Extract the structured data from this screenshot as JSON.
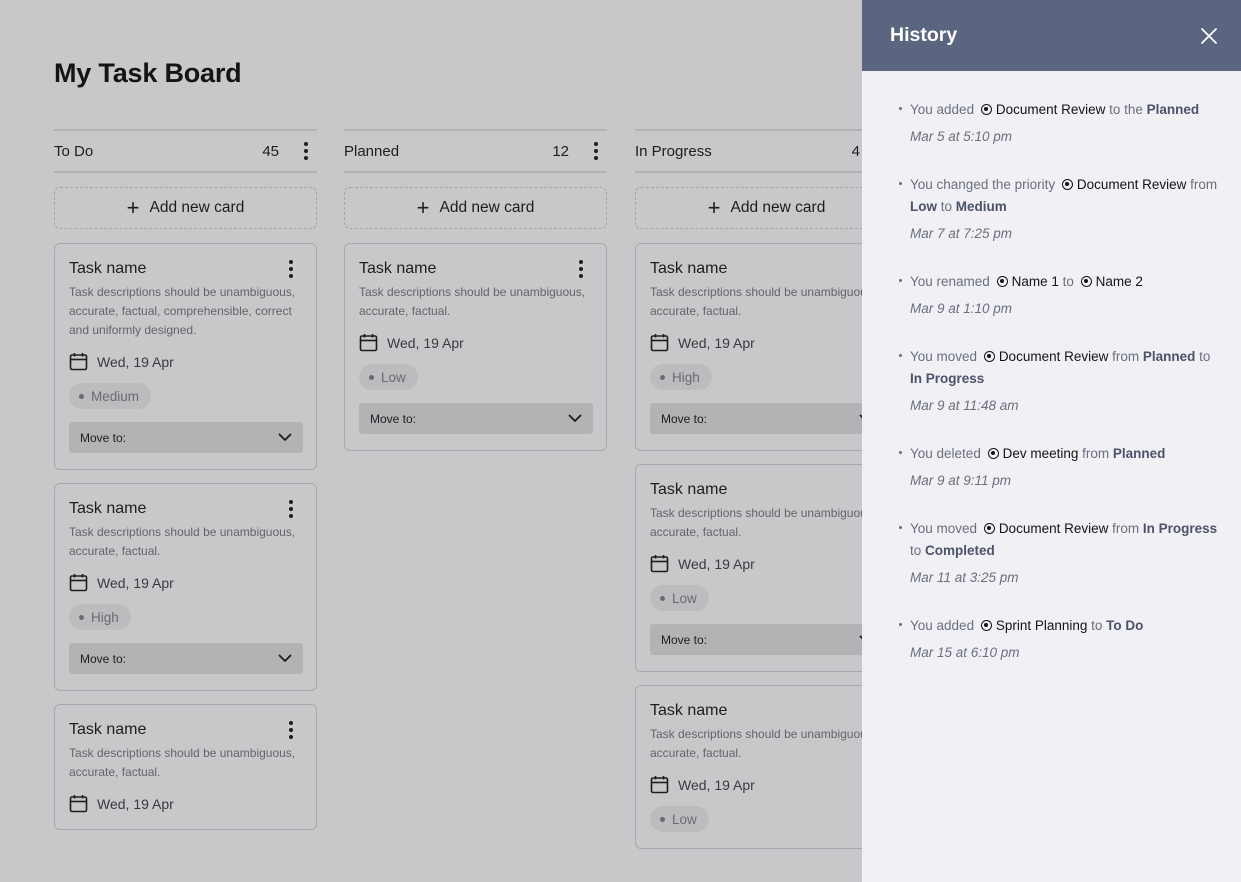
{
  "board": {
    "title": "My Task Board",
    "add_card_label": "Add new card",
    "columns": [
      {
        "name": "To Do",
        "count": "45",
        "cards": [
          {
            "title": "Task name",
            "description": "Task descriptions should be unambiguous, accurate, factual, comprehensible, correct and uniformly designed.",
            "date": "Wed, 19 Apr",
            "priority": "Medium",
            "move_label": "Move to:"
          },
          {
            "title": "Task name",
            "description": "Task descriptions should be unambiguous, accurate, factual.",
            "date": "Wed, 19 Apr",
            "priority": "High",
            "move_label": "Move to:"
          },
          {
            "title": "Task name",
            "description": "Task descriptions should be unambiguous, accurate, factual.",
            "date": "Wed, 19 Apr",
            "priority": "",
            "move_label": ""
          }
        ]
      },
      {
        "name": "Planned",
        "count": "12",
        "cards": [
          {
            "title": "Task name",
            "description": "Task descriptions should be unambiguous, accurate, factual.",
            "date": "Wed, 19 Apr",
            "priority": "Low",
            "move_label": "Move to:"
          }
        ]
      },
      {
        "name": "In Progress",
        "count": "4",
        "cards": [
          {
            "title": "Task name",
            "description": "Task descriptions should be unambiguous, accurate, factual.",
            "date": "Wed, 19 Apr",
            "priority": "High",
            "move_label": "Move to:"
          },
          {
            "title": "Task name",
            "description": "Task descriptions should be unambiguous, accurate, factual.",
            "date": "Wed, 19 Apr",
            "priority": "Low",
            "move_label": "Move to:"
          },
          {
            "title": "Task name",
            "description": "Task descriptions should be unambiguous, accurate, factual.",
            "date": "Wed, 19 Apr",
            "priority": "Low",
            "move_label": ""
          }
        ]
      }
    ]
  },
  "history": {
    "title": "History",
    "entries": [
      {
        "time": "Mar 5 at 5:10 pm",
        "parts": [
          {
            "t": "You added "
          },
          {
            "t": "Document Review",
            "k": "item"
          },
          {
            "t": " to the "
          },
          {
            "t": "Planned",
            "k": "strong"
          }
        ]
      },
      {
        "time": "Mar 7 at 7:25 pm",
        "parts": [
          {
            "t": "You changed the priority "
          },
          {
            "t": "Document Review",
            "k": "item"
          },
          {
            "t": " from "
          },
          {
            "t": "Low",
            "k": "strong"
          },
          {
            "t": " to "
          },
          {
            "t": "Medium",
            "k": "strong"
          }
        ]
      },
      {
        "time": "Mar 9 at 1:10 pm",
        "parts": [
          {
            "t": "You renamed "
          },
          {
            "t": "Name 1",
            "k": "item"
          },
          {
            "t": " to "
          },
          {
            "t": "Name 2",
            "k": "item"
          }
        ]
      },
      {
        "time": "Mar 9 at 11:48 am",
        "parts": [
          {
            "t": "You moved "
          },
          {
            "t": "Document Review",
            "k": "item"
          },
          {
            "t": " from "
          },
          {
            "t": "Planned",
            "k": "strong"
          },
          {
            "t": " to "
          },
          {
            "t": "In Progress",
            "k": "strong"
          }
        ]
      },
      {
        "time": "Mar 9 at 9:11 pm",
        "parts": [
          {
            "t": "You deleted "
          },
          {
            "t": "Dev meeting",
            "k": "item"
          },
          {
            "t": " from "
          },
          {
            "t": "Planned",
            "k": "strong"
          }
        ]
      },
      {
        "time": "Mar 11 at 3:25 pm",
        "parts": [
          {
            "t": "You moved "
          },
          {
            "t": "Document Review",
            "k": "item"
          },
          {
            "t": " from "
          },
          {
            "t": "In Progress",
            "k": "strong"
          },
          {
            "t": " to "
          },
          {
            "t": "Completed",
            "k": "strong"
          }
        ]
      },
      {
        "time": "Mar 15 at 6:10 pm",
        "parts": [
          {
            "t": "You added "
          },
          {
            "t": "Sprint Planning",
            "k": "item"
          },
          {
            "t": " to "
          },
          {
            "t": "To Do",
            "k": "strong"
          }
        ]
      }
    ]
  }
}
